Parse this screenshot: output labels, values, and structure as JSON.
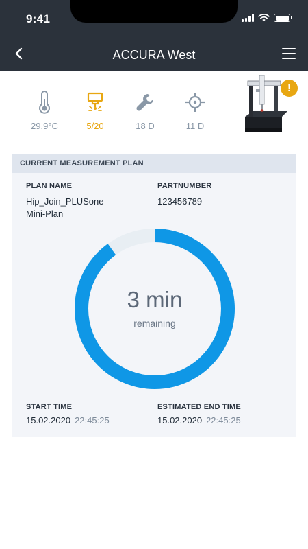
{
  "status_bar": {
    "time": "9:41"
  },
  "nav": {
    "title": "ACCURA West"
  },
  "kpis": [
    {
      "icon": "thermometer-icon",
      "value": "29.9°C"
    },
    {
      "icon": "probe-icon",
      "value": "5/20",
      "state": "warning"
    },
    {
      "icon": "wrench-icon",
      "value": "18 D"
    },
    {
      "icon": "crosshair-icon",
      "value": "11 D"
    }
  ],
  "machine": {
    "alert": "!"
  },
  "plan": {
    "header": "CURRENT MEASUREMENT PLAN",
    "plan_name_label": "PLAN NAME",
    "plan_name_line1": "Hip_Join_PLUSone",
    "plan_name_line2": "Mini-Plan",
    "partnumber_label": "PARTNUMBER",
    "partnumber": "123456789",
    "progress": {
      "remaining_value": "3 min",
      "remaining_label": "remaining",
      "completed_fraction": 0.9
    },
    "start_time_label": "START TIME",
    "start_date": "15.02.2020",
    "start_clock": "22:45:25",
    "end_time_label": "ESTIMATED END TIME",
    "end_date": "15.02.2020",
    "end_clock": "22:45:25"
  },
  "colors": {
    "header_bg": "#2b323b",
    "accent_blue": "#0f97e6",
    "warning": "#e8a712",
    "ring_track": "#e8eef3"
  }
}
